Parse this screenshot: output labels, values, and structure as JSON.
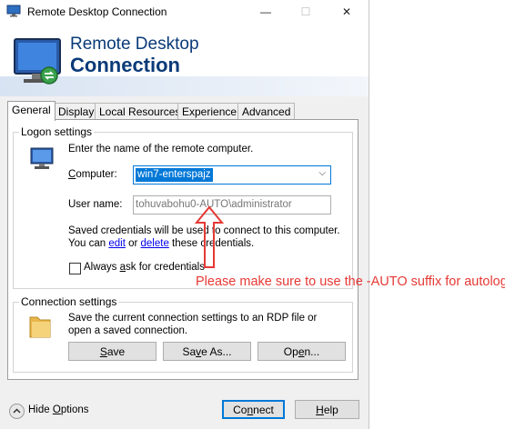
{
  "window": {
    "title": "Remote Desktop Connection",
    "controls": {
      "minimize": "—",
      "maximize": "☐",
      "close": "✕"
    }
  },
  "banner": {
    "line1": "Remote Desktop",
    "line2": "Connection"
  },
  "tabs": [
    {
      "label": "General",
      "active": true
    },
    {
      "label": "Display"
    },
    {
      "label": "Local Resources"
    },
    {
      "label": "Experience"
    },
    {
      "label": "Advanced"
    }
  ],
  "logon": {
    "legend": "Logon settings",
    "instruction": "Enter the name of the remote computer.",
    "computer_label": "Computer:",
    "computer_value": "win7-enterspajz",
    "username_label": "User name:",
    "username_value": "tohuvabohu0-AUTO\\administrator",
    "saved_text_1": "Saved credentials will be used to connect to this computer.",
    "saved_text_2a": "You can ",
    "edit_link": "edit",
    "saved_text_2b": " or ",
    "delete_link": "delete",
    "saved_text_2c": " these credentials.",
    "always_ask_label": "Always ask for credentials",
    "always_ask_checked": false
  },
  "connection": {
    "legend": "Connection settings",
    "text": "Save the current connection settings to an RDP file or open a saved connection.",
    "save": "Save",
    "save_as": "Save As...",
    "open": "Open..."
  },
  "footer": {
    "hide_options": "Hide Options",
    "connect": "Connect",
    "help": "Help"
  },
  "annotation": {
    "text": "Please make sure to use the -AUTO suffix for autologin",
    "color": "#e53935"
  },
  "colors": {
    "accent": "#0078d7",
    "title_blue": "#0a3a78"
  }
}
